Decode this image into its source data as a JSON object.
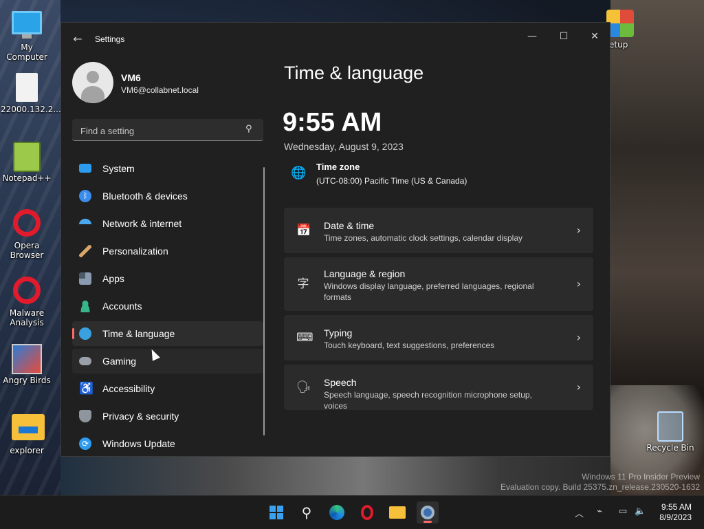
{
  "desktop": {
    "icons": [
      {
        "label": "My Computer",
        "icon": "computer-icon"
      },
      {
        "label": "22000.132.2...",
        "icon": "file-icon"
      },
      {
        "label": "Notepad++",
        "icon": "notepad-icon"
      },
      {
        "label": "Opera Browser",
        "icon": "opera-icon"
      },
      {
        "label": "Malware Analysis",
        "icon": "opera-icon"
      },
      {
        "label": "Angry Birds",
        "icon": "game-icon"
      },
      {
        "label": "explorer",
        "icon": "folder-icon"
      },
      {
        "label": "etup",
        "icon": "setup-icon"
      },
      {
        "label": "Recycle Bin",
        "icon": "recycle-bin-icon"
      }
    ],
    "watermark_line1": "Windows 11 Pro Insider Preview",
    "watermark_line2": "Evaluation copy. Build 25375.zn_release.230520-1632"
  },
  "window": {
    "title": "Settings",
    "controls": {
      "minimize": "—",
      "maximize": "☐",
      "close": "✕"
    }
  },
  "profile": {
    "name": "VM6",
    "email": "VM6@collabnet.local"
  },
  "search": {
    "placeholder": "Find a setting"
  },
  "nav": {
    "items": [
      {
        "label": "System",
        "icon": "system-icon",
        "color": "#2d9cf0"
      },
      {
        "label": "Bluetooth & devices",
        "icon": "bluetooth-icon",
        "color": "#3b8ded"
      },
      {
        "label": "Network & internet",
        "icon": "wifi-icon",
        "color": "#4aa8ef"
      },
      {
        "label": "Personalization",
        "icon": "brush-icon",
        "color": "#d9a66a"
      },
      {
        "label": "Apps",
        "icon": "apps-icon",
        "color": "#8a9bb0"
      },
      {
        "label": "Accounts",
        "icon": "person-icon",
        "color": "#36b58a"
      },
      {
        "label": "Time & language",
        "icon": "globe-clock-icon",
        "color": "#3aa0e0"
      },
      {
        "label": "Gaming",
        "icon": "controller-icon",
        "color": "#9aa0a8"
      },
      {
        "label": "Accessibility",
        "icon": "accessibility-icon",
        "color": "#3b8ded"
      },
      {
        "label": "Privacy & security",
        "icon": "shield-icon",
        "color": "#8f959c"
      },
      {
        "label": "Windows Update",
        "icon": "update-icon",
        "color": "#2d9cf0"
      }
    ]
  },
  "main": {
    "title": "Time & language",
    "time": "9:55 AM",
    "date": "Wednesday, August 9, 2023",
    "timezone": {
      "label": "Time zone",
      "value": "(UTC-08:00) Pacific Time (US & Canada)"
    },
    "cards": [
      {
        "title": "Date & time",
        "desc": "Time zones, automatic clock settings, calendar display",
        "icon": "calendar-clock-icon"
      },
      {
        "title": "Language & region",
        "desc": "Windows display language, preferred languages, regional formats",
        "icon": "language-icon"
      },
      {
        "title": "Typing",
        "desc": "Touch keyboard, text suggestions, preferences",
        "icon": "keyboard-icon"
      },
      {
        "title": "Speech",
        "desc": "Speech language, speech recognition microphone setup, voices",
        "icon": "speech-icon"
      }
    ]
  },
  "taskbar": {
    "time": "9:55 AM",
    "date": "8/9/2023",
    "accent": "#ff6b6b"
  }
}
